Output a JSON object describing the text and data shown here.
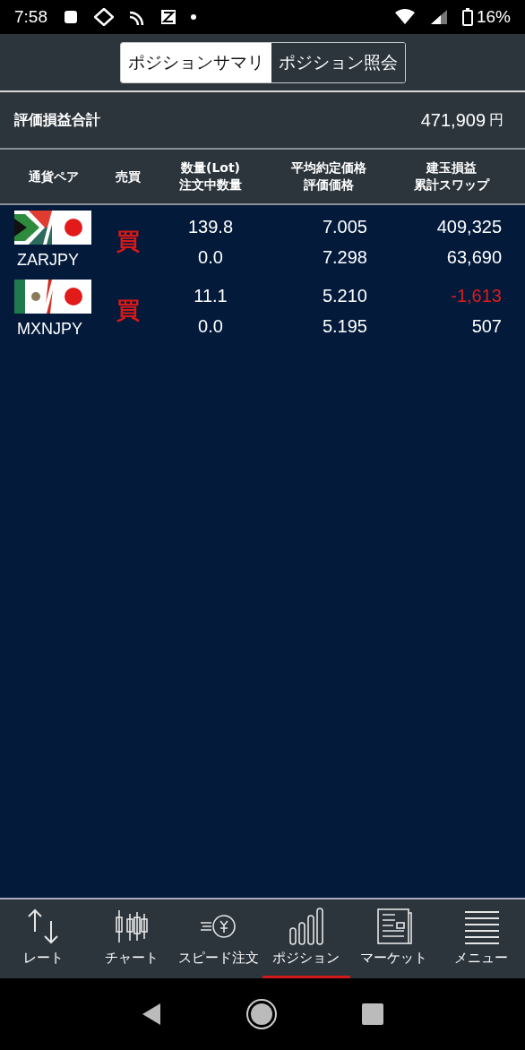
{
  "status_bar": {
    "time": "7:58",
    "battery": "16%"
  },
  "tabs": [
    {
      "label": "ポジションサマリ",
      "selected": true
    },
    {
      "label": "ポジション照会",
      "selected": false
    }
  ],
  "summary": {
    "label": "評価損益合計",
    "value": "471,909",
    "unit": "円"
  },
  "table": {
    "columns": [
      [
        "通貨ペア"
      ],
      [
        "売買"
      ],
      [
        "数量(Lot)",
        "注文中数量"
      ],
      [
        "平均約定価格",
        "評価価格"
      ],
      [
        "建玉損益",
        "累計スワップ"
      ]
    ],
    "rows": [
      {
        "kind": "za",
        "pair": "ZARJPY",
        "side": "買",
        "lots": "139.8",
        "pending": "0.0",
        "avg_price": "7.005",
        "eval_price": "7.298",
        "pnl": {
          "value": "409,325",
          "loss": false
        },
        "swap": "63,690"
      },
      {
        "kind": "mx",
        "pair": "MXNJPY",
        "side": "買",
        "lots": "11.1",
        "pending": "0.0",
        "avg_price": "5.210",
        "eval_price": "5.195",
        "pnl": {
          "value": "-1,613",
          "loss": true
        },
        "swap": "507"
      }
    ]
  },
  "bottom_nav": [
    {
      "kind": "rate",
      "label": "レート",
      "selected": false
    },
    {
      "kind": "chart",
      "label": "チャート",
      "selected": false
    },
    {
      "kind": "speed",
      "label": "スピード注文",
      "selected": false
    },
    {
      "kind": "position",
      "label": "ポジション",
      "selected": true
    },
    {
      "kind": "market",
      "label": "マーケット",
      "selected": false
    },
    {
      "kind": "menu",
      "label": "メニュー",
      "selected": false
    }
  ]
}
